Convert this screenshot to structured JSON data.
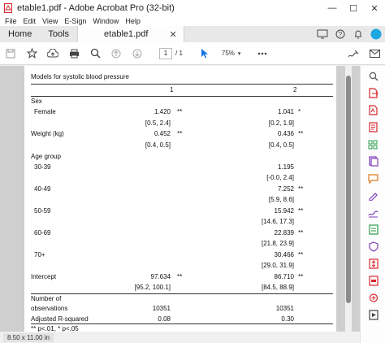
{
  "window": {
    "title": "etable1.pdf - Adobe Acrobat Pro (32-bit)",
    "controls": [
      "—",
      "☐",
      "✕"
    ]
  },
  "menu": [
    "File",
    "Edit",
    "View",
    "E-Sign",
    "Window",
    "Help"
  ],
  "tabs": {
    "home": "Home",
    "tools": "Tools",
    "document": "etable1.pdf"
  },
  "toolbar": {
    "page_current": "1",
    "page_total": "/ 1",
    "zoom": "75%"
  },
  "status": {
    "dims": "8.50 x 11.00 in"
  },
  "table": {
    "caption": "Models for systolic blood pressure",
    "col1": "1",
    "col2": "2",
    "sex": "Sex",
    "female": "Female",
    "female_m1": "1.420",
    "female_m1_sig": "**",
    "female_m2": "1.041",
    "female_m2_sig": "*",
    "female_ci1": "[0.5,   2.4]",
    "female_ci2": "[0.2,   1.9]",
    "weight": "Weight (kg)",
    "weight_m1": "0.452",
    "weight_m1_sig": "**",
    "weight_m2": "0.436",
    "weight_m2_sig": "**",
    "weight_ci1": "[0.4,   0.5]",
    "weight_ci2": "[0.4,   0.5]",
    "age_group": "Age group",
    "a3039": "30-39",
    "a3039_m2": "1.195",
    "a3039_ci2": "[-0.0,   2.4]",
    "a4049": "40-49",
    "a4049_m2": "7.252",
    "a4049_m2_sig": "**",
    "a4049_ci2": "[5.9,   8.6]",
    "a5059": "50-59",
    "a5059_m2": "15.942",
    "a5059_m2_sig": "**",
    "a5059_ci2": "[14.6,  17.3]",
    "a6069": "60-69",
    "a6069_m2": "22.839",
    "a6069_m2_sig": "**",
    "a6069_ci2": "[21.8,  23.9]",
    "a70": "70+",
    "a70_m2": "30.466",
    "a70_m2_sig": "**",
    "a70_ci2": "[29.0,  31.9]",
    "intercept": "Intercept",
    "intercept_m1": "97.634",
    "intercept_m1_sig": "**",
    "intercept_m2": "86.710",
    "intercept_m2_sig": "**",
    "intercept_ci1": "[95.2, 100.1]",
    "intercept_ci2": "[84.5,  88.9]",
    "nobs_line1": "Number of",
    "nobs_line2": "observations",
    "nobs_m1": "10351",
    "nobs_m2": "10351",
    "adjr2": "Adjusted R-squared",
    "adjr2_m1": "0.08",
    "adjr2_m2": "0.30",
    "footnote": "** p<.01, * p<.05"
  },
  "colors": {
    "accent": "#1473e6",
    "pdf_red": "#d9272e",
    "share_purple": "#7c3cb8",
    "fill_green": "#2a9d4b"
  }
}
